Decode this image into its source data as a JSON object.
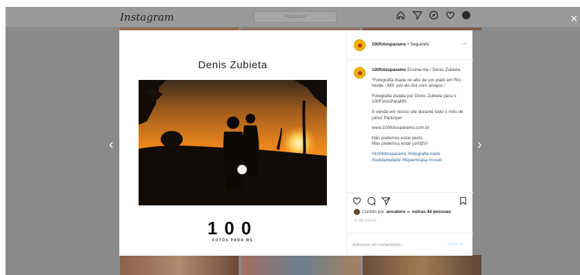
{
  "nav": {
    "logo": "Instagram",
    "search_placeholder": "Pesquisar"
  },
  "icons": [
    "home-icon",
    "explore-icon",
    "compass-icon",
    "heart-icon",
    "profile-avatar"
  ],
  "modal": {
    "close": "×",
    "prev": "‹",
    "next": "›",
    "post_image": {
      "title": "Denis Zubieta",
      "number": "100",
      "subtitle": "FOTOS PARA MS"
    },
    "header": {
      "username": "100fotosparams",
      "follow_status": "• Seguindo",
      "more": "···"
    },
    "caption": {
      "username": "100fotosparams",
      "first_line": "Ensina-me / Denis Zubieta",
      "paragraphs": [
        "\"Fotografia tirada no alto de um platô em Rio Verde - MS: pôr-do-Sol com amigos.\"",
        "Fotografia doada por Denis Zubieta para o 100FotosParaMS",
        "À venda em nosso site durante todo o mês de julho! Participe!",
        "www.100fotosparams.com.br",
        "Não podemos estar perto.\nMas podemos estar junt@s!"
      ],
      "hashtags": "#100fotosparams #fotografia #arte #solidariedade #fiquemcasa #covid"
    },
    "likes": {
      "prefix": "Curtido por",
      "user": "ancatoro",
      "connector": "e",
      "others": "outras 44 pessoas"
    },
    "date": "10 DE JULHO",
    "comment": {
      "placeholder": "Adicione um comentário...",
      "publish": "Publicar"
    }
  }
}
